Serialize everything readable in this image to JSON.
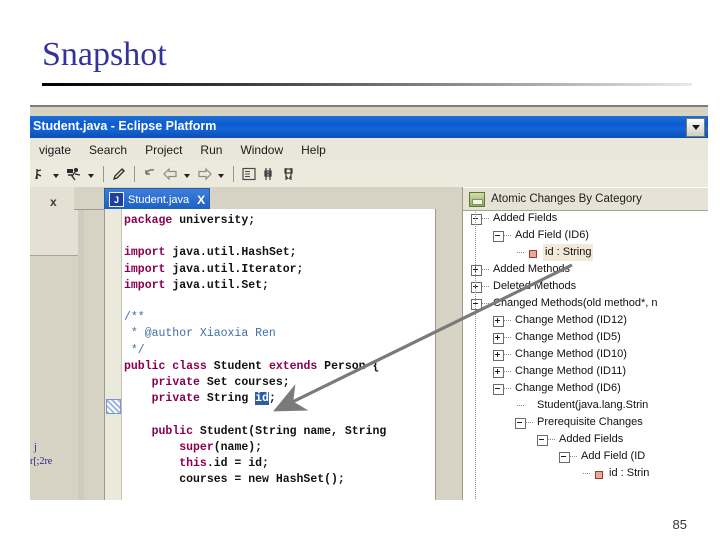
{
  "slide": {
    "title": "Snapshot",
    "page_number": "85",
    "title_color": "#333399"
  },
  "window": {
    "titlebar": {
      "text": "Student.java - Eclipse Platform",
      "dropdown_icon": "chevron-down-icon",
      "bg_color": "#0a5ad0"
    },
    "menu": [
      {
        "label": "vigate"
      },
      {
        "label": "Search"
      },
      {
        "label": "Project"
      },
      {
        "label": "Run"
      },
      {
        "label": "Window"
      },
      {
        "label": "Help"
      }
    ],
    "toolbar": [
      {
        "name": "run-icon"
      },
      {
        "name": "run-dropdown-caret"
      },
      {
        "name": "debug-icon"
      },
      {
        "name": "debug-dropdown-caret"
      },
      {
        "name": "separator"
      },
      {
        "name": "pencil-icon"
      },
      {
        "name": "separator"
      },
      {
        "name": "back-arrow-icon"
      },
      {
        "name": "previous-arrow-icon"
      },
      {
        "name": "previous-dropdown-caret"
      },
      {
        "name": "next-arrow-icon"
      },
      {
        "name": "next-dropdown-caret"
      },
      {
        "name": "separator"
      },
      {
        "name": "new-window-icon"
      },
      {
        "name": "toggle-marker-icon"
      },
      {
        "name": "compare-icon"
      }
    ]
  },
  "left_stub": {
    "close_label": "x",
    "ghost_text_1": "j",
    "ghost_text_2": "r[;2re"
  },
  "editor": {
    "tab": {
      "icon_letter": "J",
      "label": "Student.java",
      "close_label": "X"
    },
    "code_lines": [
      {
        "segments": [
          {
            "t": "package",
            "c": "kw"
          },
          {
            "t": " university;",
            "c": "pl"
          }
        ]
      },
      {
        "segments": [
          {
            "t": "",
            "c": "pl"
          }
        ]
      },
      {
        "segments": [
          {
            "t": "import",
            "c": "kw"
          },
          {
            "t": " java.util.HashSet;",
            "c": "pl"
          }
        ]
      },
      {
        "segments": [
          {
            "t": "import",
            "c": "kw"
          },
          {
            "t": " java.util.Iterator;",
            "c": "pl"
          }
        ]
      },
      {
        "segments": [
          {
            "t": "import",
            "c": "kw"
          },
          {
            "t": " java.util.Set;",
            "c": "pl"
          }
        ]
      },
      {
        "segments": [
          {
            "t": "",
            "c": "pl"
          }
        ]
      },
      {
        "segments": [
          {
            "t": "/**",
            "c": "cmt"
          }
        ]
      },
      {
        "segments": [
          {
            "t": " * @author Xiaoxia Ren",
            "c": "cmt"
          }
        ]
      },
      {
        "segments": [
          {
            "t": " */",
            "c": "cmt"
          }
        ]
      },
      {
        "segments": [
          {
            "t": "public class",
            "c": "kw"
          },
          {
            "t": " Student ",
            "c": "pl"
          },
          {
            "t": "extends",
            "c": "kw"
          },
          {
            "t": " Person {",
            "c": "pl"
          }
        ]
      },
      {
        "segments": [
          {
            "t": "    ",
            "c": "pl"
          },
          {
            "t": "private",
            "c": "kw"
          },
          {
            "t": " Set courses;",
            "c": "pl"
          }
        ]
      },
      {
        "segments": [
          {
            "t": "    ",
            "c": "pl"
          },
          {
            "t": "private",
            "c": "kw"
          },
          {
            "t": " String ",
            "c": "pl"
          },
          {
            "t": "id",
            "c": "sel"
          },
          {
            "t": ";",
            "c": "pl"
          }
        ]
      },
      {
        "segments": [
          {
            "t": "",
            "c": "pl"
          }
        ]
      },
      {
        "segments": [
          {
            "t": "    ",
            "c": "pl"
          },
          {
            "t": "public",
            "c": "kw"
          },
          {
            "t": " Student(String name, String",
            "c": "pl"
          }
        ]
      },
      {
        "segments": [
          {
            "t": "        ",
            "c": "pl"
          },
          {
            "t": "super",
            "c": "kw"
          },
          {
            "t": "(name);",
            "c": "pl"
          }
        ]
      },
      {
        "segments": [
          {
            "t": "        ",
            "c": "pl"
          },
          {
            "t": "this",
            "c": "kw"
          },
          {
            "t": ".id = id;",
            "c": "pl"
          }
        ]
      },
      {
        "segments": [
          {
            "t": "        courses = new HashSet();",
            "c": "pl"
          }
        ]
      }
    ],
    "scrollbar": {
      "up_arrow": "scroll-up-icon"
    }
  },
  "right_view": {
    "icon": "atomic-changes-icon",
    "title": "Atomic Changes By Category",
    "tree": [
      {
        "label": "Added Fields",
        "indent": 0,
        "toggle": "minus",
        "leaf": false,
        "highlight": false
      },
      {
        "label": "Add Field (ID6)",
        "indent": 1,
        "toggle": "minus",
        "leaf": false,
        "highlight": false
      },
      {
        "label": "id : String",
        "indent": 2,
        "toggle": "none",
        "leaf": true,
        "highlight": true
      },
      {
        "label": "Added Methods",
        "indent": 0,
        "toggle": "plus",
        "leaf": false,
        "highlight": false
      },
      {
        "label": "Deleted Methods",
        "indent": 0,
        "toggle": "plus",
        "leaf": false,
        "highlight": false
      },
      {
        "label": "Changed Methods(old method*, n",
        "indent": 0,
        "toggle": "minus",
        "leaf": false,
        "highlight": false
      },
      {
        "label": "Change Method (ID12)",
        "indent": 1,
        "toggle": "plus",
        "leaf": false,
        "highlight": false
      },
      {
        "label": "Change Method (ID5)",
        "indent": 1,
        "toggle": "plus",
        "leaf": false,
        "highlight": false
      },
      {
        "label": "Change Method (ID10)",
        "indent": 1,
        "toggle": "plus",
        "leaf": false,
        "highlight": false
      },
      {
        "label": "Change Method (ID11)",
        "indent": 1,
        "toggle": "plus",
        "leaf": false,
        "highlight": false
      },
      {
        "label": "Change Method (ID6)",
        "indent": 1,
        "toggle": "minus",
        "leaf": false,
        "highlight": false
      },
      {
        "label": "Student(java.lang.Strin",
        "indent": 2,
        "toggle": "none",
        "leaf": false,
        "highlight": false
      },
      {
        "label": "Prerequisite Changes",
        "indent": 2,
        "toggle": "minus",
        "leaf": false,
        "highlight": false
      },
      {
        "label": "Added Fields",
        "indent": 3,
        "toggle": "minus",
        "leaf": false,
        "highlight": false
      },
      {
        "label": "Add Field (ID",
        "indent": 4,
        "toggle": "minus",
        "leaf": false,
        "highlight": false
      },
      {
        "label": "id : Strin",
        "indent": 5,
        "toggle": "none",
        "leaf": true,
        "highlight": false
      }
    ]
  },
  "annotation": {
    "arrow_name": "connector-arrow",
    "from": "id : String tree node",
    "to": "id identifier in code"
  }
}
